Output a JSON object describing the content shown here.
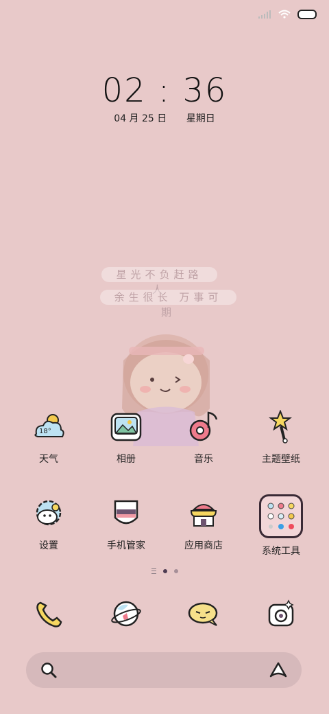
{
  "status_bar": {
    "icons": [
      "signal-icon",
      "wifi-icon",
      "battery-icon"
    ]
  },
  "lockclock": {
    "time": "02 : 36",
    "date": "04 月 25 日",
    "weekday": "星期日"
  },
  "quotes": [
    "星光不负赶路人",
    "余生很长 万事可期"
  ],
  "apps_row1": [
    {
      "label": "天气",
      "icon": "weather-cloud-icon",
      "temp": "18°"
    },
    {
      "label": "相册",
      "icon": "photo-album-icon"
    },
    {
      "label": "音乐",
      "icon": "music-note-icon"
    },
    {
      "label": "主题壁纸",
      "icon": "magic-wand-star-icon"
    }
  ],
  "apps_row2": [
    {
      "label": "设置",
      "icon": "settings-gear-icon"
    },
    {
      "label": "手机管家",
      "icon": "shield-icon"
    },
    {
      "label": "应用商店",
      "icon": "store-icon"
    },
    {
      "label": "系统工具",
      "icon": "folder-icon"
    }
  ],
  "page_indicator": {
    "pages": 2,
    "active": 1
  },
  "dock": [
    {
      "icon": "phone-icon"
    },
    {
      "icon": "browser-planet-icon"
    },
    {
      "icon": "message-bubble-icon"
    },
    {
      "icon": "camera-icon"
    }
  ],
  "search_bar": {
    "left_icon": "search-icon",
    "right_icon": "assistant-icon"
  },
  "colors": {
    "background": "#e8c9c9",
    "accent": "#4e3c52",
    "search_bg": "#d6b9bb"
  }
}
